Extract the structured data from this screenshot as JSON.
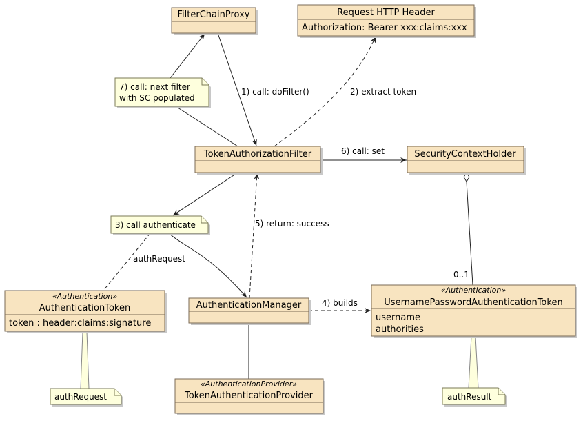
{
  "classes": {
    "filter_chain_proxy": {
      "name": "FilterChainProxy"
    },
    "request_header": {
      "name": "Request HTTP Header",
      "attributes": [
        "Authorization: Bearer xxx:claims:xxx"
      ]
    },
    "token_authorization_filter": {
      "name": "TokenAuthorizationFilter"
    },
    "security_context_holder": {
      "name": "SecurityContextHolder"
    },
    "authentication_token": {
      "stereotype": "«Authentication»",
      "name": "AuthenticationToken",
      "attributes": [
        "token : header:claims:signature"
      ]
    },
    "authentication_manager": {
      "name": "AuthenticationManager"
    },
    "upat": {
      "stereotype": "«Authentication»",
      "name": "UsernamePasswordAuthenticationToken",
      "attributes": [
        "username",
        "authorities"
      ]
    },
    "token_auth_provider": {
      "stereotype": "«AuthenticationProvider»",
      "name": "TokenAuthenticationProvider"
    }
  },
  "notes": {
    "note7": [
      "7) call: next filter",
      "with SC populated"
    ],
    "note3": "3) call authenticate",
    "auth_request": "authRequest",
    "auth_result": "authResult"
  },
  "edges": {
    "e1": "1) call: doFilter()",
    "e2": "2) extract token",
    "e3": "authRequest",
    "e4": "4) builds",
    "e5": "5) return: success",
    "e6": "6) call: set",
    "multiplicity": "0..1"
  },
  "colors": {
    "class_fill": "#F8E4C0",
    "note_fill": "#FEFFDD"
  }
}
